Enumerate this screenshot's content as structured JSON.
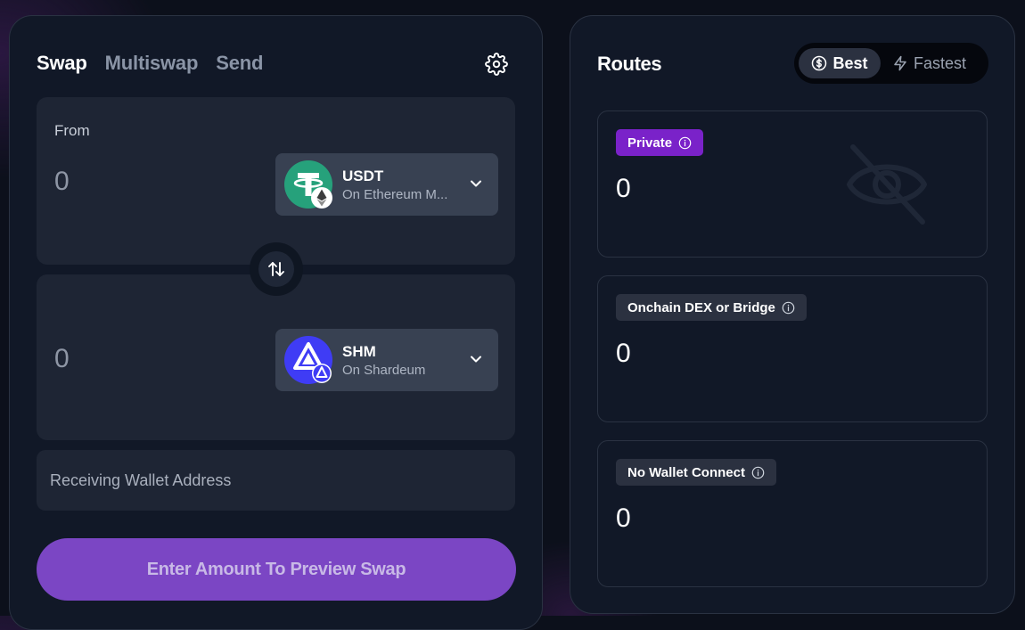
{
  "swap": {
    "tabs": [
      "Swap",
      "Multiswap",
      "Send"
    ],
    "from_label": "From",
    "from_amount": "0",
    "from_token": {
      "symbol": "USDT",
      "network": "On Ethereum M..."
    },
    "to_amount": "0",
    "to_token": {
      "symbol": "SHM",
      "network": "On Shardeum"
    },
    "address_placeholder": "Receiving Wallet Address",
    "cta_label": "Enter Amount To Preview Swap"
  },
  "routes": {
    "title": "Routes",
    "toggle": {
      "best": "Best",
      "fastest": "Fastest",
      "selected": "Best"
    },
    "cards": [
      {
        "badge": "Private",
        "value": "0",
        "badge_color": "#7a22c9"
      },
      {
        "badge": "Onchain DEX or Bridge",
        "value": "0",
        "badge_color": "#2b3140"
      },
      {
        "badge": "No Wallet Connect",
        "value": "0",
        "badge_color": "#2b3140"
      }
    ]
  },
  "colors": {
    "accent": "#7b46c4",
    "usdt": "#26a17b",
    "shm": "#3f3cf5"
  },
  "icons": [
    "gear-icon",
    "chevron-down-icon",
    "swap-arrows-icon",
    "dollar-circle-icon",
    "lightning-icon",
    "info-icon",
    "eye-off-icon",
    "ethereum-icon",
    "tether-icon",
    "shardeum-icon"
  ]
}
